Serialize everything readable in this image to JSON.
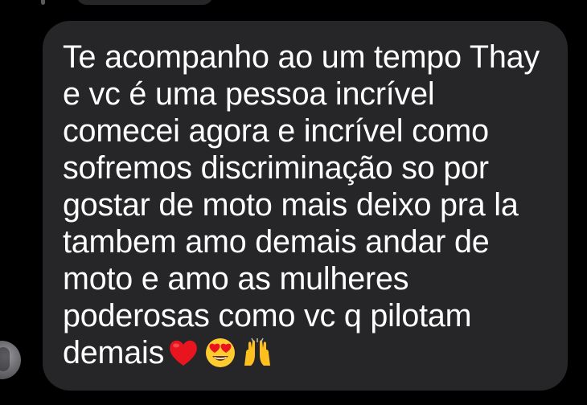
{
  "message": {
    "lines": [
      "Te acompanho ao um tempo Thay",
      "e vc é uma pessoa incrível",
      "comecei agora e incrível como",
      "sofremos discriminação so por",
      "gostar de moto mais deixo pra la",
      "tambem amo demais andar de",
      "moto e amo as mulheres",
      "poderosas como vc q pilotam"
    ],
    "last_line": "demais",
    "emojis": [
      "red-heart-emoji",
      "heart-eyes-emoji",
      "raising-hands-emoji"
    ]
  },
  "colors": {
    "background": "#000000",
    "bubble": "#262628",
    "text": "#ffffff"
  }
}
